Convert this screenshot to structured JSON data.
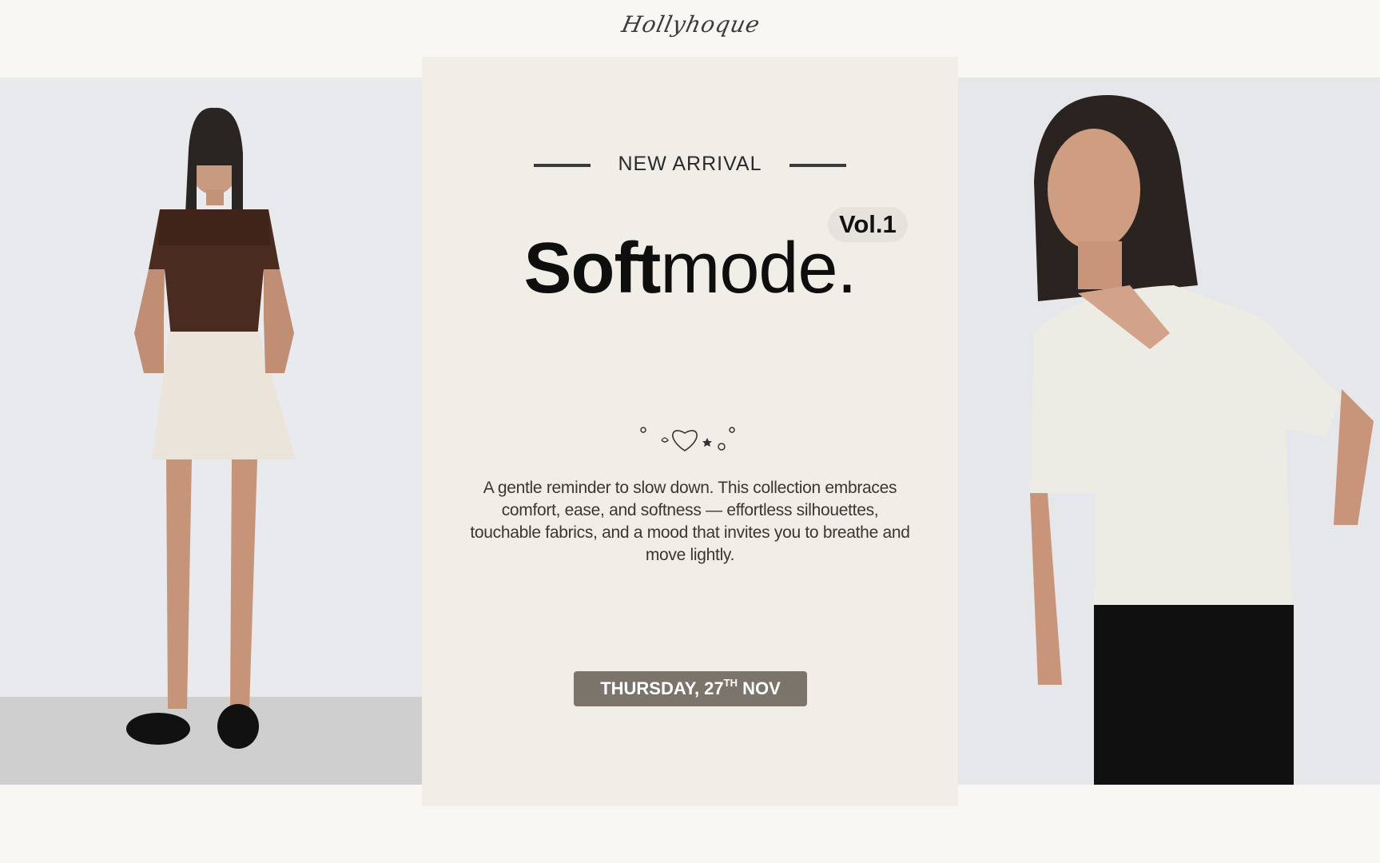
{
  "brand": {
    "logo_text": "Hollyhoque"
  },
  "campaign": {
    "eyebrow": "NEW ARRIVAL",
    "title_bold": "Soft",
    "title_light": "mode.",
    "volume_badge": "Vol.1",
    "description": "A gentle reminder to slow down. This collection embraces comfort, ease, and softness — effortless silhouettes, touchable fabrics, and a mood that invites you to breathe and move lightly.",
    "date": {
      "day": "THURSDAY, 27",
      "suffix": "TH",
      "month": "NOV"
    }
  },
  "colors": {
    "page_bg": "#f8f7f3",
    "panel_bg": "#f1eee8",
    "button_bg": "#7b746b",
    "text_dark": "#0e0e0e"
  },
  "icons": [
    "heart-doodle-icon"
  ]
}
